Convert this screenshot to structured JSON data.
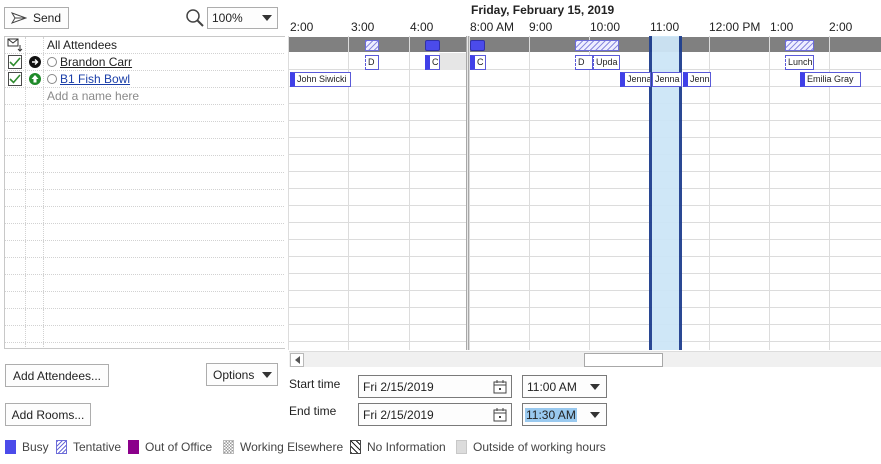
{
  "toolbar": {
    "send_label": "Send",
    "zoom_value": "100%"
  },
  "list": {
    "header": "All Attendees",
    "attendees": [
      {
        "name": "Brandon Carr"
      },
      {
        "name": "B1 Fish Bowl"
      }
    ],
    "add_placeholder": "Add a name here"
  },
  "grid": {
    "date_header": "Friday, February 15, 2019",
    "hours": [
      "2:00",
      "3:00",
      "4:00",
      "8:00 AM",
      "9:00",
      "10:00",
      "11:00",
      "12:00 PM",
      "1:00",
      "2:00"
    ],
    "appointments": {
      "brandon_1": "D",
      "brandon_2": "C",
      "brandon_3": "C",
      "brandon_4": "D",
      "brandon_5": "Upda",
      "brandon_6": "Lunch",
      "fish_1": "John Siwicki",
      "fish_2": "Jenna",
      "fish_3": "Jenna",
      "fish_4": "Jenna",
      "fish_5": "Emilia Gray"
    }
  },
  "buttons": {
    "add_attendees": "Add Attendees...",
    "options": "Options",
    "add_rooms": "Add Rooms..."
  },
  "time": {
    "start_label": "Start time",
    "end_label": "End time",
    "start_date": "Fri 2/15/2019",
    "start_time": "11:00 AM",
    "end_date": "Fri 2/15/2019",
    "end_time": "11:30 AM"
  },
  "legend": {
    "busy": "Busy",
    "tentative": "Tentative",
    "out_of_office": "Out of Office",
    "working_elsewhere": "Working Elsewhere",
    "no_information": "No Information",
    "outside_hours": "Outside of working hours"
  },
  "colors": {
    "busy": "#4b4bea",
    "out_of_office": "#8b008b",
    "selection": "#cde6f7",
    "selection_border": "#1f3f8f",
    "header_bar": "#808080"
  }
}
